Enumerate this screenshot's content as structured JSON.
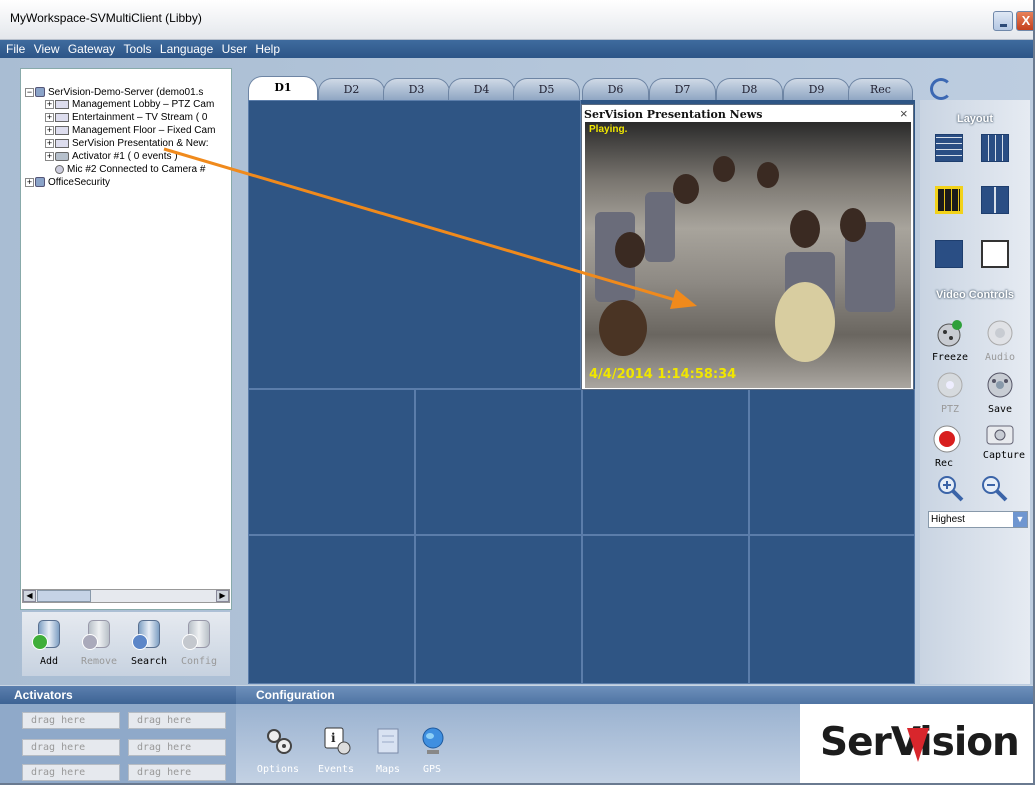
{
  "window": {
    "title": "MyWorkspace-SVMultiClient (Libby)",
    "close_glyph": "X"
  },
  "menu": [
    "File",
    "View",
    "Gateway",
    "Tools",
    "Language",
    "User",
    "Help"
  ],
  "tree": {
    "nodes": [
      {
        "label": "SerVision-Demo-Server (demo01.s",
        "expander": "−",
        "icon": "server-icon"
      },
      {
        "label": "Management Lobby – PTZ Cam",
        "expander": "+",
        "icon": "camera-icon"
      },
      {
        "label": "Entertainment – TV Stream ( 0",
        "expander": "+",
        "icon": "camera-icon"
      },
      {
        "label": "Management Floor – Fixed Cam",
        "expander": "+",
        "icon": "camera-icon"
      },
      {
        "label": "SerVision Presentation & New:",
        "expander": "+",
        "icon": "camera-icon"
      },
      {
        "label": "Activator #1 ( 0 events )",
        "expander": "+",
        "icon": "activator-icon"
      },
      {
        "label": "Mic #2 Connected to Camera #",
        "expander": "",
        "icon": "microphone-icon"
      },
      {
        "label": "OfficeSecurity",
        "expander": "+",
        "icon": "server-icon"
      }
    ],
    "scroll_left": "◀",
    "scroll_right": "▶"
  },
  "tree_toolbar": {
    "add": "Add",
    "remove": "Remove",
    "search": "Search",
    "config": "Config"
  },
  "tabs": [
    "D1",
    "D2",
    "D3",
    "D4",
    "D5",
    "D6",
    "D7",
    "D8",
    "D9",
    "Rec"
  ],
  "active_tab": "D1",
  "video_window": {
    "title": "SerVision Presentation News",
    "status": "Playing.",
    "timestamp": "4/4/2014 1:14:58:34",
    "close_glyph": "×"
  },
  "right_panel": {
    "layout_title": "Layout",
    "video_controls_title": "Video Controls",
    "freeze": "Freeze",
    "audio": "Audio",
    "ptz": "PTZ",
    "save": "Save",
    "rec": "Rec",
    "capture": "Capture",
    "quality": "Highest",
    "quality_dropdown": "▼"
  },
  "bottom": {
    "activators_title": "Activators",
    "configuration_title": "Configuration",
    "drag_slots": [
      "drag  here",
      "drag  here",
      "drag  here",
      "drag  here",
      "drag  here",
      "drag  here"
    ],
    "options": "Options",
    "events": "Events",
    "maps": "Maps",
    "gps": "GPS",
    "logo": "SerVision"
  },
  "colors": {
    "accent": "#2e5585",
    "menubar": "#2d5587",
    "video_status": "#f0e600",
    "annotation_arrow": "#f08a1c",
    "logo_red": "#d8262c"
  }
}
